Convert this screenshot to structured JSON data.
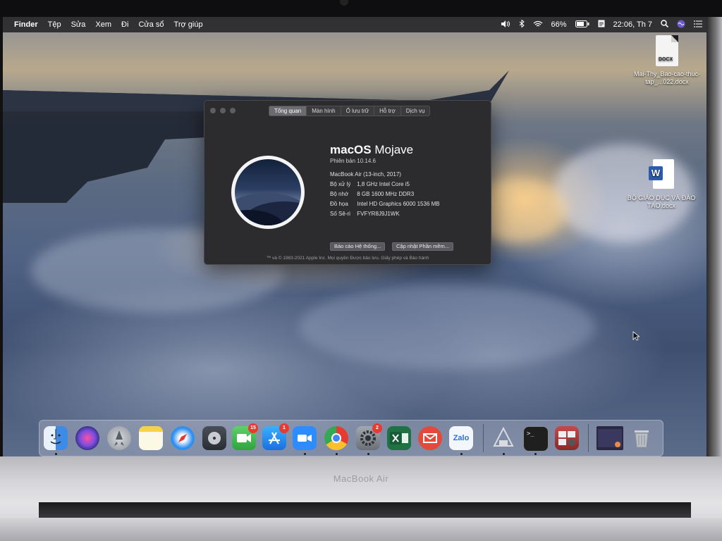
{
  "menubar": {
    "app_name": "Finder",
    "items": [
      "Tệp",
      "Sửa",
      "Xem",
      "Đi",
      "Cửa sổ",
      "Trợ giúp"
    ],
    "battery": "66%",
    "clock": "22:06, Th 7",
    "status_icons": [
      "volume-icon",
      "bluetooth-icon",
      "wifi-icon",
      "battery-icon",
      "notes-icon",
      "search-icon",
      "siri-icon",
      "notification-center-icon"
    ]
  },
  "desktop": {
    "icons": [
      {
        "label": "Mai-Thy_Bao-cao-thuc-tap_...022.docx",
        "badge": "DOCX",
        "icon": "docx-file-icon"
      },
      {
        "label": "BỘ GIÁO DỤC VÀ ĐÀO TẠO.docx",
        "icon": "word-document-icon"
      }
    ]
  },
  "about_window": {
    "tabs": [
      {
        "label": "Tổng quan",
        "active": true
      },
      {
        "label": "Màn hình",
        "active": false
      },
      {
        "label": "Ổ lưu trữ",
        "active": false
      },
      {
        "label": "Hỗ trợ",
        "active": false
      },
      {
        "label": "Dịch vụ",
        "active": false
      }
    ],
    "os_name_bold": "macOS",
    "os_name_light": "Mojave",
    "version": "Phiên bản 10.14.6",
    "model": "MacBook Air (13-inch, 2017)",
    "specs": [
      {
        "key": "Bộ xử lý",
        "value": "1,8 GHz Intel Core i5"
      },
      {
        "key": "Bộ nhớ",
        "value": "8 GB 1600 MHz DDR3"
      },
      {
        "key": "Đồ họa",
        "value": "Intel HD Graphics 6000 1536 MB"
      },
      {
        "key": "Số Sê-ri",
        "value": "FVFYR8J9J1WK"
      }
    ],
    "buttons": {
      "system_report": "Báo cáo Hệ thống...",
      "software_update": "Cập nhật Phần mềm..."
    },
    "copyright": "™ và © 1983-2021 Apple Inc. Mọi quyền Được bảo lưu. Giấy phép và Bảo hành"
  },
  "dock": {
    "apps": [
      {
        "name": "Finder",
        "icon": "finder-icon",
        "color": "#3e8be6",
        "running": true
      },
      {
        "name": "Siri",
        "icon": "siri-icon",
        "color": "#7b4de0",
        "running": false
      },
      {
        "name": "Launchpad",
        "icon": "launchpad-icon",
        "color": "#9aa0a8",
        "running": false
      },
      {
        "name": "Notes",
        "icon": "notes-icon",
        "color": "#f4e08a",
        "running": false
      },
      {
        "name": "Safari",
        "icon": "safari-icon",
        "color": "#2f8ff0",
        "running": false
      },
      {
        "name": "Disk Utility",
        "icon": "disk-utility-icon",
        "color": "#6b6f78",
        "running": false
      },
      {
        "name": "FaceTime",
        "icon": "facetime-icon",
        "color": "#39b54a",
        "badge": "15",
        "running": false
      },
      {
        "name": "App Store",
        "icon": "app-store-icon",
        "color": "#2b8ef0",
        "badge": "1",
        "running": false
      },
      {
        "name": "Zoom",
        "icon": "zoom-icon",
        "color": "#2d8cff",
        "running": true
      },
      {
        "name": "Chrome",
        "icon": "chrome-icon",
        "color": "#e8e8e8",
        "running": true
      },
      {
        "name": "System Preferences",
        "icon": "system-preferences-icon",
        "color": "#8a8f97",
        "badge": "2",
        "running": true
      },
      {
        "name": "Excel",
        "icon": "excel-icon",
        "color": "#1f7244",
        "running": false
      },
      {
        "name": "Mail",
        "icon": "mail-icon",
        "color": "#e24a3b",
        "running": false
      },
      {
        "name": "Zalo",
        "icon": "zalo-icon",
        "color": "#f3f6fb",
        "label": "Zalo",
        "running": true
      },
      {
        "name": "Network Utility",
        "icon": "network-utility-icon",
        "color": "#c9ccd2",
        "running": true
      },
      {
        "name": "Terminal",
        "icon": "terminal-icon",
        "color": "#1f1f1f",
        "running": true
      },
      {
        "name": "Photo Booth",
        "icon": "photo-booth-icon",
        "color": "#b83b3b",
        "running": false
      },
      {
        "name": "Screen Preview",
        "icon": "window-preview-icon",
        "color": "#2a2740",
        "running": false
      },
      {
        "name": "Trash",
        "icon": "trash-icon",
        "color": "#bfc3c8",
        "running": false
      }
    ]
  },
  "laptop_label": "MacBook Air"
}
